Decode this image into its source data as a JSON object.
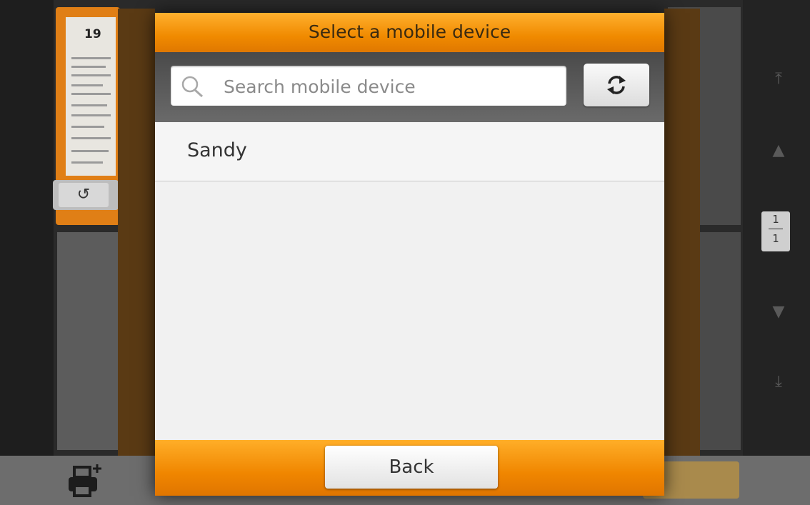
{
  "dialog": {
    "title": "Select a mobile device",
    "search": {
      "placeholder": "Search mobile device",
      "value": ""
    },
    "refresh_icon": "refresh-icon",
    "devices": [
      {
        "name": "Sandy"
      }
    ],
    "back_label": "Back"
  },
  "background": {
    "thumbnail": {
      "page_number": "19",
      "rotate_icon": "rotate-icon"
    },
    "pager": {
      "current": "1",
      "total": "1"
    },
    "nav_icons": [
      "first-page-icon",
      "prev-page-icon",
      "next-page-icon",
      "last-page-icon"
    ],
    "print_icon": "add-printer-icon"
  },
  "colors": {
    "accent_orange": "#f08a00",
    "overlay_dark": "#2a2a2a"
  }
}
